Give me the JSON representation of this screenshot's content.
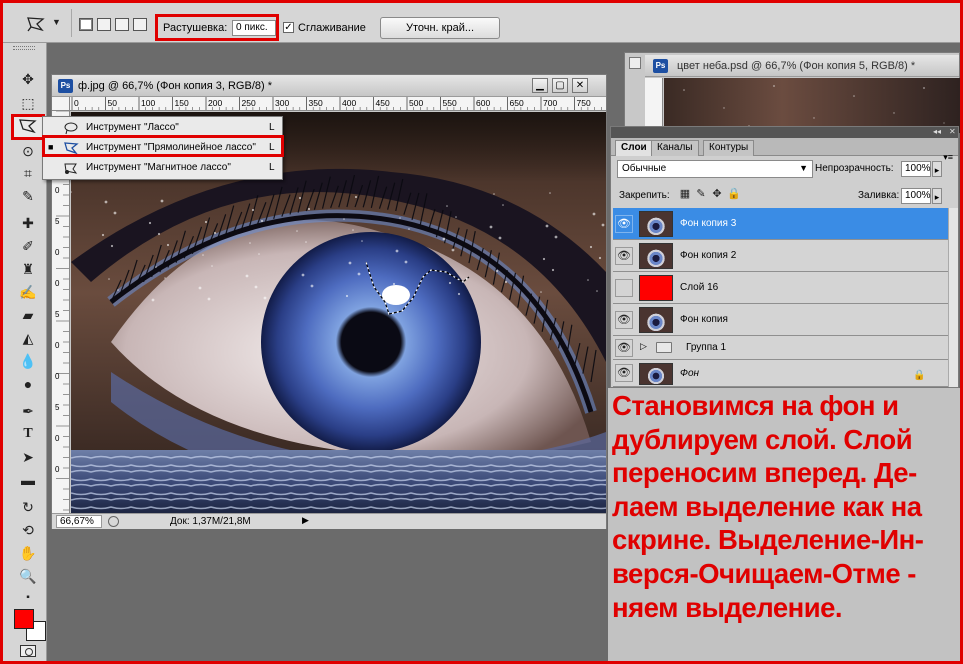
{
  "options_bar": {
    "feather_label": "Растушевка:",
    "feather_value": "0 пикс.",
    "antialias_checked": "✓",
    "antialias_label": "Сглаживание",
    "refine_edge_label": "Уточн. край..."
  },
  "document": {
    "title": "ф.jpg @ 66,7% (Фон копия 3, RGB/8) *",
    "ps_badge": "Ps",
    "ruler_ticks": [
      "0",
      "50",
      "100",
      "150",
      "200",
      "250",
      "300",
      "350",
      "400",
      "450",
      "500",
      "550",
      "600",
      "650",
      "700",
      "750"
    ],
    "zoom": "66,67%",
    "doc_info": "Док: 1,37M/21,8M"
  },
  "second_document": {
    "title": "цвет неба.psd @ 66,7% (Фон копия 5, RGB/8) *",
    "ps_badge": "Ps"
  },
  "tool_flyout": {
    "items": [
      {
        "bullet": "",
        "label": "Инструмент \"Лассо\"",
        "shortcut": "L"
      },
      {
        "bullet": "■",
        "label": "Инструмент \"Прямолинейное лассо\"",
        "shortcut": "L"
      },
      {
        "bullet": "",
        "label": "Инструмент \"Магнитное лассо\"",
        "shortcut": "L"
      }
    ]
  },
  "layers_panel": {
    "tabs": [
      "Слои",
      "Каналы",
      "Контуры"
    ],
    "blend_mode": "Обычные",
    "opacity_label": "Непрозрачность:",
    "opacity_value": "100%",
    "lock_label": "Закрепить:",
    "fill_label": "Заливка:",
    "fill_value": "100%",
    "layers": [
      {
        "name": "Фон копия 3",
        "selected": true,
        "visible": true
      },
      {
        "name": "Фон копия 2",
        "selected": false,
        "visible": true
      },
      {
        "name": "Слой 16",
        "selected": false,
        "visible": false
      },
      {
        "name": "Фон копия",
        "selected": false,
        "visible": true
      },
      {
        "name": "Группа 1",
        "selected": false,
        "visible": true
      },
      {
        "name": "Фон",
        "selected": false,
        "visible": true
      }
    ]
  },
  "instruction": {
    "lines": [
      "Становимся на фон и",
      "дублируем слой. Слой",
      "переносим вперед. Де-",
      "лаем выделение как на",
      "скрине. Выделение-Ин-",
      "верся-Очищаем-Отме -",
      "няем выделение."
    ]
  },
  "colors": {
    "accent_red": "#e00000",
    "foreground": "#ff0000",
    "background": "#ffffff",
    "selection_blue": "#3a8ce5"
  }
}
